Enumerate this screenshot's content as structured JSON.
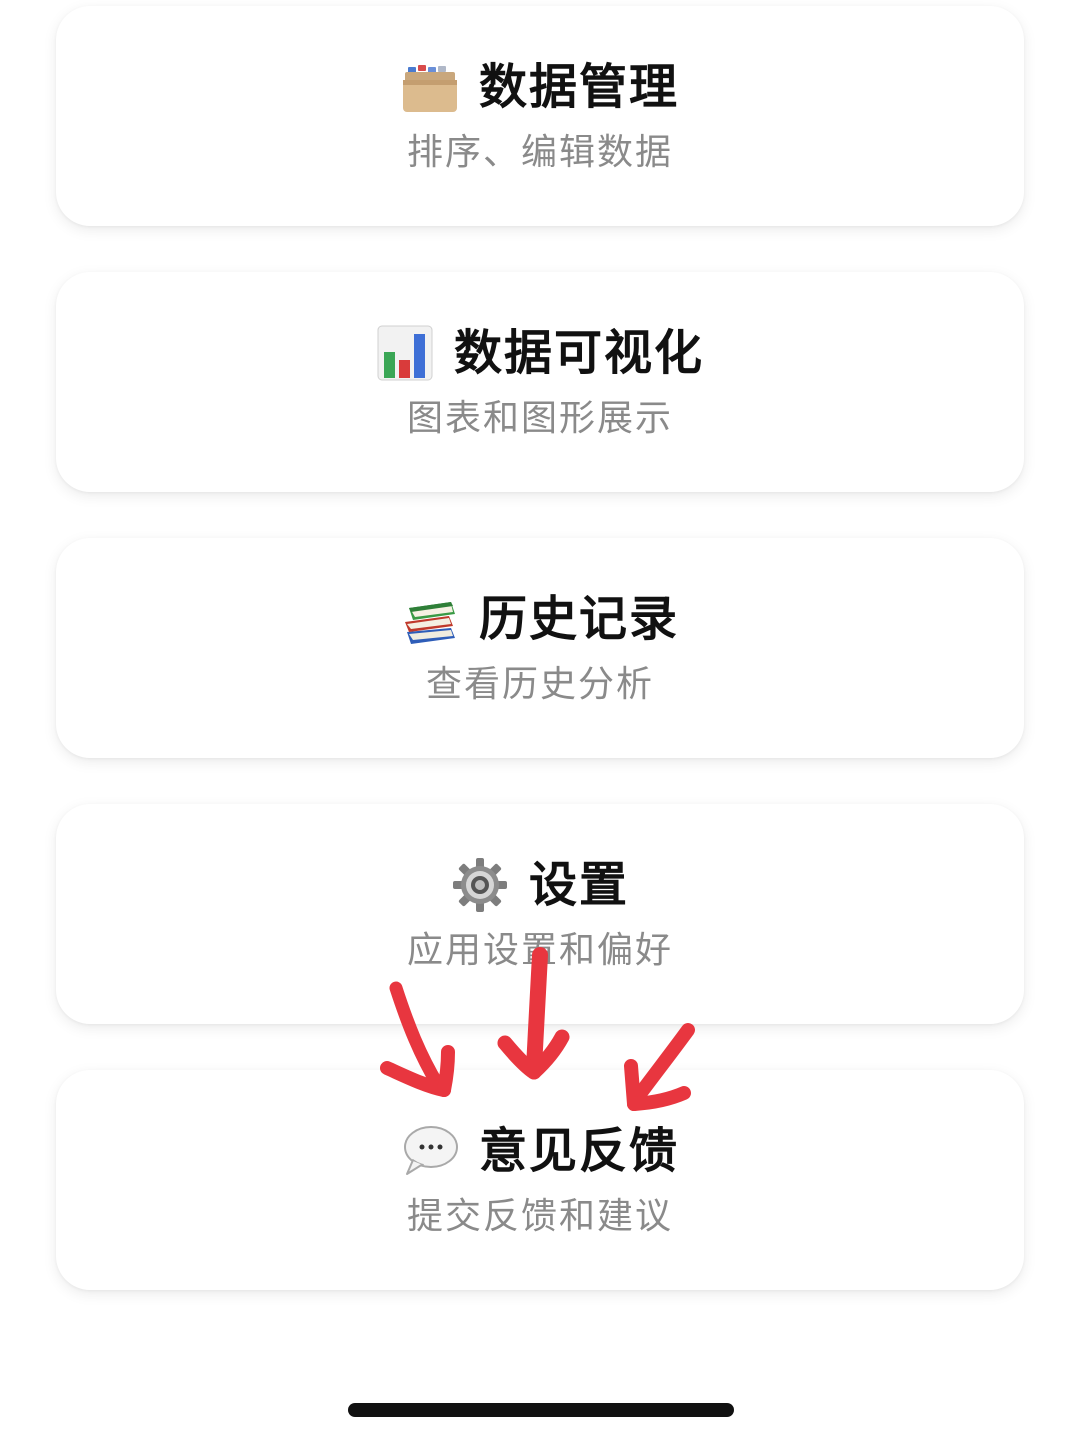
{
  "menu": {
    "items": [
      {
        "icon": "card-file-box-icon",
        "title": "数据管理",
        "subtitle": "排序、编辑数据"
      },
      {
        "icon": "bar-chart-icon",
        "title": "数据可视化",
        "subtitle": "图表和图形展示"
      },
      {
        "icon": "books-icon",
        "title": "历史记录",
        "subtitle": "查看历史分析"
      },
      {
        "icon": "gear-icon",
        "title": "设置",
        "subtitle": "应用设置和偏好"
      },
      {
        "icon": "speech-bubble-icon",
        "title": "意见反馈",
        "subtitle": "提交反馈和建议"
      }
    ]
  },
  "annotation": {
    "arrow_color": "#e8363f",
    "arrow_count": 3
  }
}
